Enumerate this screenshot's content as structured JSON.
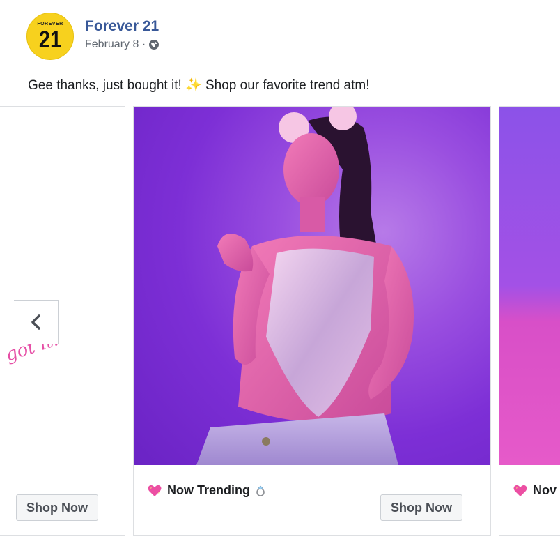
{
  "post": {
    "logo_top": "FOREVER",
    "logo_number": "21",
    "page_name": "Forever 21",
    "date": "February 8 ·",
    "text_before": "Gee thanks, just bought it! ",
    "sparkle": "✨",
    "text_after": " Shop our favorite trend atm!"
  },
  "carousel": {
    "left_card": {
      "script_text": "got it!",
      "button": "Shop Now"
    },
    "main_card": {
      "caption": "Now Trending",
      "button": "Shop Now"
    },
    "right_card": {
      "caption": "Nov"
    }
  },
  "icons": {
    "globe": "globe-icon",
    "heart": "sparkling-heart-icon",
    "ring": "ring-icon",
    "prev": "chevron-left-icon"
  },
  "colors": {
    "link": "#385898",
    "brand_yellow": "#f7d11e",
    "accent_pink": "#e64fa6",
    "background_purple": "#7d2fd6"
  }
}
